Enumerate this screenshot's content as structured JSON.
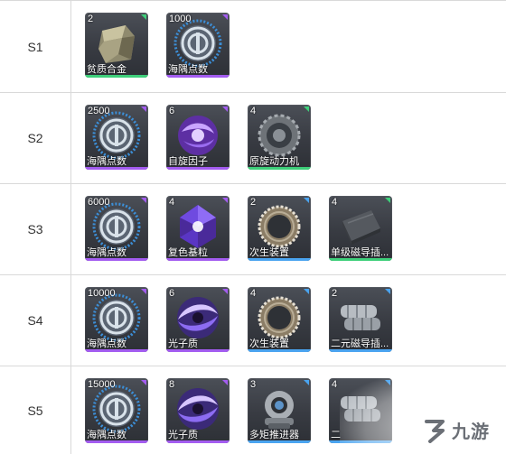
{
  "rarity_colors": {
    "green": "#3ecf7a",
    "purple": "#a35cf0",
    "blue": "#4aa4f0"
  },
  "rows": [
    {
      "label": "S1",
      "items": [
        {
          "qty": "2",
          "name": "贫质合金",
          "rarity": "green",
          "icon": "metal-ore-icon"
        },
        {
          "qty": "1000",
          "name": "海隅点数",
          "rarity": "purple",
          "icon": "haiyu-point-icon"
        }
      ]
    },
    {
      "label": "S2",
      "items": [
        {
          "qty": "2500",
          "name": "海隅点数",
          "rarity": "purple",
          "icon": "haiyu-point-icon"
        },
        {
          "qty": "6",
          "name": "自旋因子",
          "rarity": "purple",
          "icon": "spin-orb-icon"
        },
        {
          "qty": "4",
          "name": "原旋动力机",
          "rarity": "green",
          "icon": "ring-engine-icon"
        }
      ]
    },
    {
      "label": "S3",
      "items": [
        {
          "qty": "6000",
          "name": "海隅点数",
          "rarity": "purple",
          "icon": "haiyu-point-icon"
        },
        {
          "qty": "4",
          "name": "复色基粒",
          "rarity": "purple",
          "icon": "crystal-icon"
        },
        {
          "qty": "2",
          "name": "次生装置",
          "rarity": "blue",
          "icon": "bearing-ring-icon"
        },
        {
          "qty": "4",
          "name": "单级磁导插...",
          "rarity": "green",
          "icon": "magnetic-plate-icon"
        }
      ]
    },
    {
      "label": "S4",
      "items": [
        {
          "qty": "10000",
          "name": "海隅点数",
          "rarity": "purple",
          "icon": "haiyu-point-icon"
        },
        {
          "qty": "6",
          "name": "光子质",
          "rarity": "purple",
          "icon": "photon-vortex-icon"
        },
        {
          "qty": "4",
          "name": "次生装置",
          "rarity": "blue",
          "icon": "bearing-ring-icon"
        },
        {
          "qty": "2",
          "name": "二元磁导插...",
          "rarity": "blue",
          "icon": "dual-cylinder-icon"
        }
      ]
    },
    {
      "label": "S5",
      "items": [
        {
          "qty": "15000",
          "name": "海隅点数",
          "rarity": "purple",
          "icon": "haiyu-point-icon"
        },
        {
          "qty": "8",
          "name": "光子质",
          "rarity": "purple",
          "icon": "photon-vortex-icon"
        },
        {
          "qty": "3",
          "name": "多矩推进器",
          "rarity": "blue",
          "icon": "thruster-icon"
        },
        {
          "qty": "4",
          "name": "二",
          "rarity": "blue",
          "icon": "dual-cylinder-icon"
        }
      ]
    }
  ],
  "watermark": {
    "text": "九游",
    "icon": "jiuyou-logo-icon"
  }
}
